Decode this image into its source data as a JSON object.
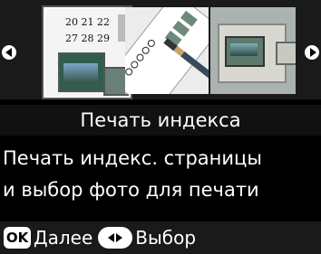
{
  "title": "Печать индекса",
  "description": {
    "line1": "Печать индекс. страницы",
    "line2": "и выбор фото для печати"
  },
  "thumbnails": {
    "calendar_row1": "20 21 22",
    "calendar_row2": "27 28 29"
  },
  "footer": {
    "ok_key": "OK",
    "ok_action": "Далее",
    "arrows_action": "Выбор"
  },
  "icons": {
    "prev": "triangle-left-icon",
    "next": "triangle-right-icon",
    "arrows": "left-right-arrows-icon"
  }
}
